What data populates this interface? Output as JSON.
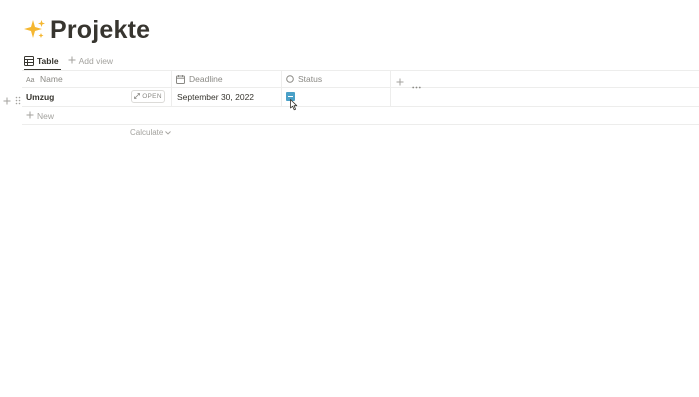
{
  "page": {
    "title": "Projekte",
    "icon": "sparkles-icon"
  },
  "views": {
    "active_tab": "Table",
    "add_view_label": "Add view"
  },
  "table": {
    "columns": [
      {
        "label": "Name",
        "icon": "text-icon"
      },
      {
        "label": "Deadline",
        "icon": "calendar-icon"
      },
      {
        "label": "Status",
        "icon": "select-icon"
      }
    ],
    "rows": [
      {
        "name": "Umzug",
        "open_label": "OPEN",
        "deadline": "September 30, 2022",
        "status_color": "#4aa0c7"
      }
    ],
    "new_label": "New",
    "calculate_label": "Calculate"
  },
  "colors": {
    "text": "#37352f",
    "muted": "#8a8984",
    "faint": "#a3a29e",
    "divider": "#ededec",
    "accent": "#4aa0c7",
    "sparkle": "#f5b731"
  }
}
